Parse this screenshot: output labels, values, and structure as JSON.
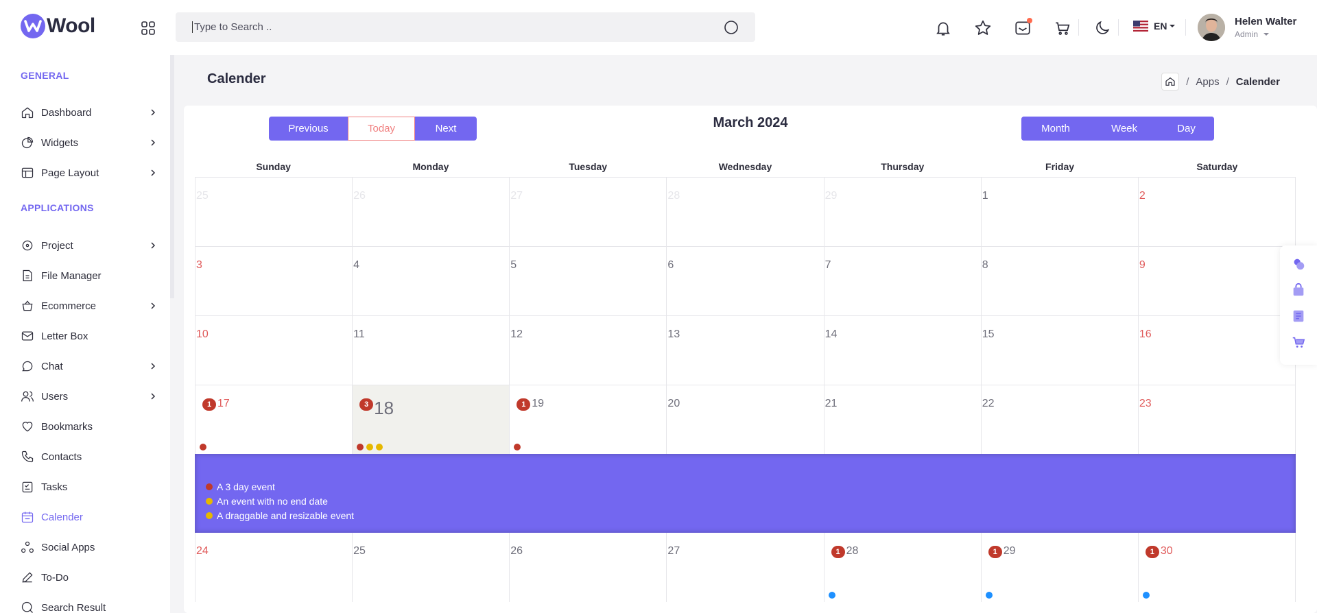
{
  "app": {
    "logo_text": "Wool"
  },
  "search": {
    "placeholder": "Type to Search .."
  },
  "header": {
    "language": "EN",
    "user": {
      "name": "Helen Walter",
      "role": "Admin"
    }
  },
  "sidebar": {
    "sections": [
      {
        "title": "GENERAL"
      },
      {
        "title": "APPLICATIONS"
      }
    ],
    "items": [
      {
        "label": "Dashboard",
        "icon": "home-icon",
        "has_children": true
      },
      {
        "label": "Widgets",
        "icon": "widgets-icon",
        "has_children": true
      },
      {
        "label": "Page Layout",
        "icon": "layout-icon",
        "has_children": true
      },
      {
        "label": "Project",
        "icon": "project-icon",
        "has_children": true
      },
      {
        "label": "File Manager",
        "icon": "file-manager-icon",
        "has_children": false
      },
      {
        "label": "Ecommerce",
        "icon": "basket-icon",
        "has_children": true
      },
      {
        "label": "Letter Box",
        "icon": "mail-icon",
        "has_children": false
      },
      {
        "label": "Chat",
        "icon": "chat-icon",
        "has_children": true
      },
      {
        "label": "Users",
        "icon": "users-icon",
        "has_children": true
      },
      {
        "label": "Bookmarks",
        "icon": "heart-icon",
        "has_children": false
      },
      {
        "label": "Contacts",
        "icon": "phone-icon",
        "has_children": false
      },
      {
        "label": "Tasks",
        "icon": "tasks-icon",
        "has_children": false
      },
      {
        "label": "Calender",
        "icon": "calendar-icon",
        "has_children": false,
        "active": true
      },
      {
        "label": "Social Apps",
        "icon": "social-icon",
        "has_children": false
      },
      {
        "label": "To-Do",
        "icon": "pen-icon",
        "has_children": false
      },
      {
        "label": "Search Result",
        "icon": "search-icon",
        "has_children": false
      }
    ]
  },
  "page": {
    "title": "Calender",
    "breadcrumb": [
      "Apps",
      "Calender"
    ]
  },
  "calendar": {
    "nav": {
      "previous": "Previous",
      "today": "Today",
      "next": "Next"
    },
    "title": "March 2024",
    "views": [
      "Month",
      "Week",
      "Day"
    ],
    "weekdays": [
      "Sunday",
      "Monday",
      "Tuesday",
      "Wednesday",
      "Thursday",
      "Friday",
      "Saturday"
    ],
    "weeks": [
      [
        "25",
        "26",
        "27",
        "28",
        "29",
        "1",
        "2"
      ],
      [
        "3",
        "4",
        "5",
        "6",
        "7",
        "8",
        "9"
      ],
      [
        "10",
        "11",
        "12",
        "13",
        "14",
        "15",
        "16"
      ],
      [
        "17",
        "18",
        "19",
        "20",
        "21",
        "22",
        "23"
      ],
      [
        "24",
        "25",
        "26",
        "27",
        "28",
        "29",
        "30"
      ]
    ],
    "event_counts": {
      "17": "1",
      "18": "3",
      "19": "1",
      "28": "1",
      "29": "1",
      "30": "1"
    },
    "expanded_events": [
      {
        "title": "A 3 day event",
        "color": "#c0392b"
      },
      {
        "title": "An event with no end date",
        "color": "#e6b800"
      },
      {
        "title": "A draggable and resizable event",
        "color": "#e6b800"
      }
    ],
    "colors": {
      "accent": "#7367f0",
      "event_red": "#c0392b",
      "event_yellow": "#e6b800",
      "event_blue": "#1e90ff",
      "weekend": "#e05a5a"
    }
  }
}
